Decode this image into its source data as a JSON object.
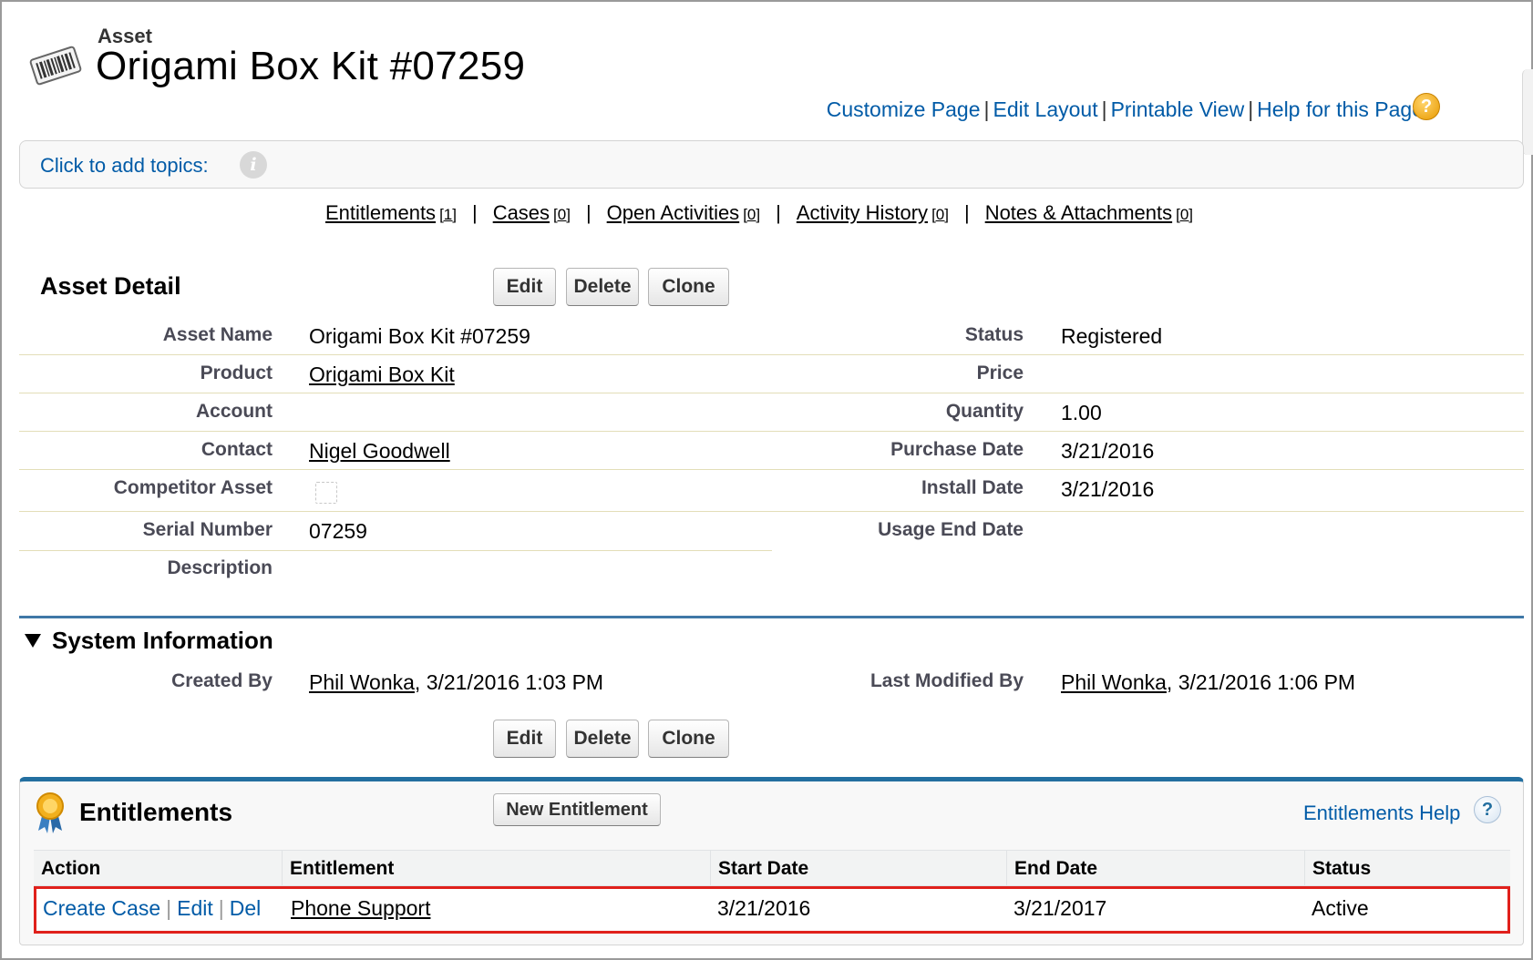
{
  "header": {
    "object_type": "Asset",
    "title": "Origami Box Kit #07259",
    "links": [
      "Customize Page",
      "Edit Layout",
      "Printable View",
      "Help for this Page"
    ]
  },
  "topics": {
    "label": "Click to add topics:"
  },
  "related_links": [
    {
      "label": "Entitlements",
      "count": "[1]"
    },
    {
      "label": "Cases",
      "count": "[0]"
    },
    {
      "label": "Open Activities",
      "count": "[0]"
    },
    {
      "label": "Activity History",
      "count": "[0]"
    },
    {
      "label": "Notes & Attachments",
      "count": "[0]"
    }
  ],
  "buttons": {
    "edit": "Edit",
    "delete": "Delete",
    "clone": "Clone"
  },
  "detail": {
    "title": "Asset Detail",
    "left": [
      {
        "label": "Asset Name",
        "value": "Origami Box Kit #07259"
      },
      {
        "label": "Product",
        "value": "Origami Box Kit"
      },
      {
        "label": "Account",
        "value": ""
      },
      {
        "label": "Contact",
        "value": "Nigel Goodwell"
      },
      {
        "label": "Competitor Asset",
        "value": ""
      },
      {
        "label": "Serial Number",
        "value": "07259"
      },
      {
        "label": "Description",
        "value": ""
      }
    ],
    "right": [
      {
        "label": "Status",
        "value": "Registered"
      },
      {
        "label": "Price",
        "value": ""
      },
      {
        "label": "Quantity",
        "value": "1.00"
      },
      {
        "label": "Purchase Date",
        "value": "3/21/2016"
      },
      {
        "label": "Install Date",
        "value": "3/21/2016"
      },
      {
        "label": "Usage End Date",
        "value": ""
      }
    ]
  },
  "system_info": {
    "title": "System Information",
    "created_by_label": "Created By",
    "created_by_user": "Phil Wonka",
    "created_by_date": ", 3/21/2016 1:03 PM",
    "modified_by_label": "Last Modified By",
    "modified_by_user": "Phil Wonka",
    "modified_by_date": ", 3/21/2016 1:06 PM"
  },
  "entitlements": {
    "title": "Entitlements",
    "new_button": "New Entitlement",
    "help": "Entitlements Help",
    "columns": [
      "Action",
      "Entitlement",
      "Start Date",
      "End Date",
      "Status"
    ],
    "row": {
      "actions": [
        "Create Case",
        "Edit",
        "Del"
      ],
      "entitlement": "Phone Support",
      "start_date": "3/21/2016",
      "end_date": "3/21/2017",
      "status": "Active"
    }
  },
  "colors": {
    "link": "#015ba7",
    "section_rule": "#3f78a7",
    "highlight": "#e0201b"
  }
}
